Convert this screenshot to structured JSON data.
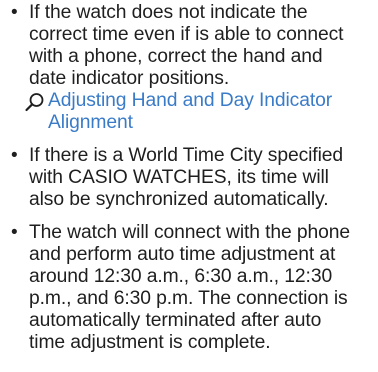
{
  "items": [
    {
      "lines": [
        "If the watch does not indicate the",
        "correct time even if is able to connect",
        "with a phone, correct the hand and",
        "date indicator positions."
      ],
      "link": {
        "lines": [
          "Adjusting Hand and Day Indicator",
          "Alignment"
        ],
        "icon": "magnifier-icon"
      }
    },
    {
      "lines": [
        "If there is a World Time City specified",
        "with CASIO WATCHES, its time will",
        "also be synchronized automatically."
      ]
    },
    {
      "lines": [
        "The watch will connect with the phone",
        "and perform auto time adjustment at",
        "around 12:30 a.m., 6:30 a.m., 12:30",
        "p.m., and 6:30 p.m. The connection is",
        "automatically terminated after auto",
        "time adjustment is complete."
      ]
    }
  ],
  "bullet_char": "•",
  "colors": {
    "text": "#1f1f1f",
    "link": "#3a7bc8"
  }
}
